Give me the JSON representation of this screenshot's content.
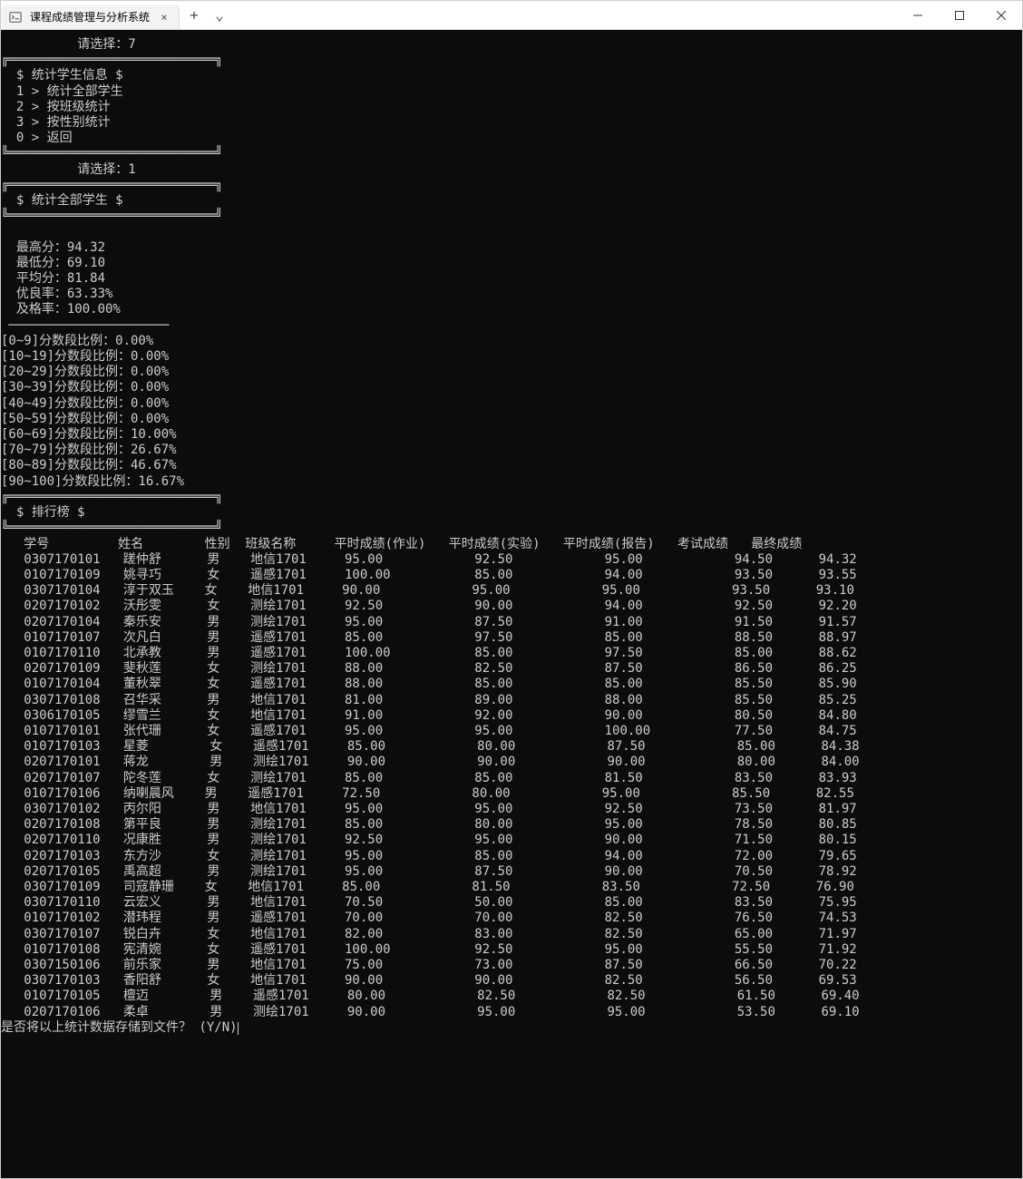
{
  "window": {
    "title": "课程成绩管理与分析系统",
    "tab_close_glyph": "×",
    "tab_add_glyph": "+",
    "tab_chevron_glyph": "⌄"
  },
  "prompt1": "          请选择：7",
  "box_top": "╔═══════════════════════════╗",
  "box_bottom": "╚═══════════════════════════╝",
  "divider": " ─────────────────────",
  "menu1": {
    "title": "  $ 统计学生信息 $",
    "items": [
      "  1 > 统计全部学生",
      "  2 > 按班级统计",
      "  3 > 按性别统计",
      "  0 > 返回"
    ]
  },
  "prompt2": "          请选择：1",
  "menu2": {
    "title": "  $ 统计全部学生 $"
  },
  "stats": {
    "lines": [
      "  最高分：94.32",
      "  最低分：69.10",
      "  平均分：81.84",
      "  优良率：63.33%",
      "  及格率：100.00%"
    ]
  },
  "ranges": [
    "[0~9]分数段比例：0.00%",
    "[10~19]分数段比例：0.00%",
    "[20~29]分数段比例：0.00%",
    "[30~39]分数段比例：0.00%",
    "[40~49]分数段比例：0.00%",
    "[50~59]分数段比例：0.00%",
    "[60~69]分数段比例：10.00%",
    "[70~79]分数段比例：26.67%",
    "[80~89]分数段比例：46.67%",
    "[90~100]分数段比例：16.67%"
  ],
  "ranking_title": "  $ 排行榜 $",
  "table_header": {
    "id": "学号",
    "name": "姓名",
    "gender": "性别",
    "class": "班级名称",
    "hw": "平时成绩(作业)",
    "exp": "平时成绩(实验)",
    "rpt": "平时成绩(报告)",
    "exam": "考试成绩",
    "final": "最终成绩"
  },
  "rows": [
    {
      "id": "0307170101",
      "name": "蹉仲舒",
      "gender": "男",
      "class": "地信1701",
      "hw": "95.00",
      "exp": "92.50",
      "rpt": "95.00",
      "exam": "94.50",
      "final": "94.32"
    },
    {
      "id": "0107170109",
      "name": "姚寻巧",
      "gender": "女",
      "class": "遥感1701",
      "hw": "100.00",
      "exp": "85.00",
      "rpt": "94.00",
      "exam": "93.50",
      "final": "93.55"
    },
    {
      "id": "0307170104",
      "name": "淳于双玉",
      "gender": "女",
      "class": "地信1701",
      "hw": "90.00",
      "exp": "95.00",
      "rpt": "95.00",
      "exam": "93.50",
      "final": "93.10"
    },
    {
      "id": "0207170102",
      "name": "沃彤雯",
      "gender": "女",
      "class": "测绘1701",
      "hw": "92.50",
      "exp": "90.00",
      "rpt": "94.00",
      "exam": "92.50",
      "final": "92.20"
    },
    {
      "id": "0207170104",
      "name": "秦乐安",
      "gender": "男",
      "class": "测绘1701",
      "hw": "95.00",
      "exp": "87.50",
      "rpt": "91.00",
      "exam": "91.50",
      "final": "91.57"
    },
    {
      "id": "0107170107",
      "name": "次凡白",
      "gender": "男",
      "class": "遥感1701",
      "hw": "85.00",
      "exp": "97.50",
      "rpt": "85.00",
      "exam": "88.50",
      "final": "88.97"
    },
    {
      "id": "0107170110",
      "name": "北承教",
      "gender": "男",
      "class": "遥感1701",
      "hw": "100.00",
      "exp": "85.00",
      "rpt": "97.50",
      "exam": "85.00",
      "final": "88.62"
    },
    {
      "id": "0207170109",
      "name": "斐秋莲",
      "gender": "女",
      "class": "测绘1701",
      "hw": "88.00",
      "exp": "82.50",
      "rpt": "87.50",
      "exam": "86.50",
      "final": "86.25"
    },
    {
      "id": "0107170104",
      "name": "董秋翠",
      "gender": "女",
      "class": "遥感1701",
      "hw": "88.00",
      "exp": "85.00",
      "rpt": "85.00",
      "exam": "85.50",
      "final": "85.90"
    },
    {
      "id": "0307170108",
      "name": "召华采",
      "gender": "男",
      "class": "地信1701",
      "hw": "81.00",
      "exp": "89.00",
      "rpt": "88.00",
      "exam": "85.50",
      "final": "85.25"
    },
    {
      "id": "0306170105",
      "name": "缪雪兰",
      "gender": "女",
      "class": "地信1701",
      "hw": "91.00",
      "exp": "92.00",
      "rpt": "90.00",
      "exam": "80.50",
      "final": "84.80"
    },
    {
      "id": "0107170101",
      "name": "张代珊",
      "gender": "女",
      "class": "遥感1701",
      "hw": "95.00",
      "exp": "95.00",
      "rpt": "100.00",
      "exam": "77.50",
      "final": "84.75"
    },
    {
      "id": "0107170103",
      "name": "星菱",
      "gender": "女",
      "class": "遥感1701",
      "hw": "85.00",
      "exp": "80.00",
      "rpt": "87.50",
      "exam": "85.00",
      "final": "84.38"
    },
    {
      "id": "0207170101",
      "name": "蒋龙",
      "gender": "男",
      "class": "测绘1701",
      "hw": "90.00",
      "exp": "90.00",
      "rpt": "90.00",
      "exam": "80.00",
      "final": "84.00"
    },
    {
      "id": "0207170107",
      "name": "陀冬莲",
      "gender": "女",
      "class": "测绘1701",
      "hw": "85.00",
      "exp": "85.00",
      "rpt": "81.50",
      "exam": "83.50",
      "final": "83.93"
    },
    {
      "id": "0107170106",
      "name": "纳喇晨风",
      "gender": "男",
      "class": "遥感1701",
      "hw": "72.50",
      "exp": "80.00",
      "rpt": "95.00",
      "exam": "85.50",
      "final": "82.55"
    },
    {
      "id": "0307170102",
      "name": "丙尔阳",
      "gender": "男",
      "class": "地信1701",
      "hw": "95.00",
      "exp": "95.00",
      "rpt": "92.50",
      "exam": "73.50",
      "final": "81.97"
    },
    {
      "id": "0207170108",
      "name": "第平良",
      "gender": "男",
      "class": "测绘1701",
      "hw": "85.00",
      "exp": "80.00",
      "rpt": "95.00",
      "exam": "78.50",
      "final": "80.85"
    },
    {
      "id": "0207170110",
      "name": "况康胜",
      "gender": "男",
      "class": "测绘1701",
      "hw": "92.50",
      "exp": "95.00",
      "rpt": "90.00",
      "exam": "71.50",
      "final": "80.15"
    },
    {
      "id": "0207170103",
      "name": "东方沙",
      "gender": "女",
      "class": "测绘1701",
      "hw": "95.00",
      "exp": "85.00",
      "rpt": "94.00",
      "exam": "72.00",
      "final": "79.65"
    },
    {
      "id": "0207170105",
      "name": "禹高超",
      "gender": "男",
      "class": "测绘1701",
      "hw": "95.00",
      "exp": "87.50",
      "rpt": "90.00",
      "exam": "70.50",
      "final": "78.92"
    },
    {
      "id": "0307170109",
      "name": "司寇静珊",
      "gender": "女",
      "class": "地信1701",
      "hw": "85.00",
      "exp": "81.50",
      "rpt": "83.50",
      "exam": "72.50",
      "final": "76.90"
    },
    {
      "id": "0307170110",
      "name": "云宏义",
      "gender": "男",
      "class": "地信1701",
      "hw": "70.50",
      "exp": "50.00",
      "rpt": "85.00",
      "exam": "83.50",
      "final": "75.95"
    },
    {
      "id": "0107170102",
      "name": "潜玮程",
      "gender": "男",
      "class": "遥感1701",
      "hw": "70.00",
      "exp": "70.00",
      "rpt": "82.50",
      "exam": "76.50",
      "final": "74.53"
    },
    {
      "id": "0307170107",
      "name": "锐白卉",
      "gender": "女",
      "class": "地信1701",
      "hw": "82.00",
      "exp": "83.00",
      "rpt": "82.50",
      "exam": "65.00",
      "final": "71.97"
    },
    {
      "id": "0107170108",
      "name": "宪清婉",
      "gender": "女",
      "class": "遥感1701",
      "hw": "100.00",
      "exp": "92.50",
      "rpt": "95.00",
      "exam": "55.50",
      "final": "71.92"
    },
    {
      "id": "0307150106",
      "name": "前乐家",
      "gender": "男",
      "class": "地信1701",
      "hw": "75.00",
      "exp": "73.00",
      "rpt": "87.50",
      "exam": "66.50",
      "final": "70.22"
    },
    {
      "id": "0307170103",
      "name": "香阳舒",
      "gender": "女",
      "class": "地信1701",
      "hw": "90.00",
      "exp": "90.00",
      "rpt": "82.50",
      "exam": "56.50",
      "final": "69.53"
    },
    {
      "id": "0107170105",
      "name": "檀迈",
      "gender": "男",
      "class": "遥感1701",
      "hw": "80.00",
      "exp": "82.50",
      "rpt": "82.50",
      "exam": "61.50",
      "final": "69.40"
    },
    {
      "id": "0207170106",
      "name": "柔卓",
      "gender": "男",
      "class": "测绘1701",
      "hw": "90.00",
      "exp": "95.00",
      "rpt": "95.00",
      "exam": "53.50",
      "final": "69.10"
    }
  ],
  "save_prompt": "是否将以上统计数据存储到文件？ (Y/N)"
}
